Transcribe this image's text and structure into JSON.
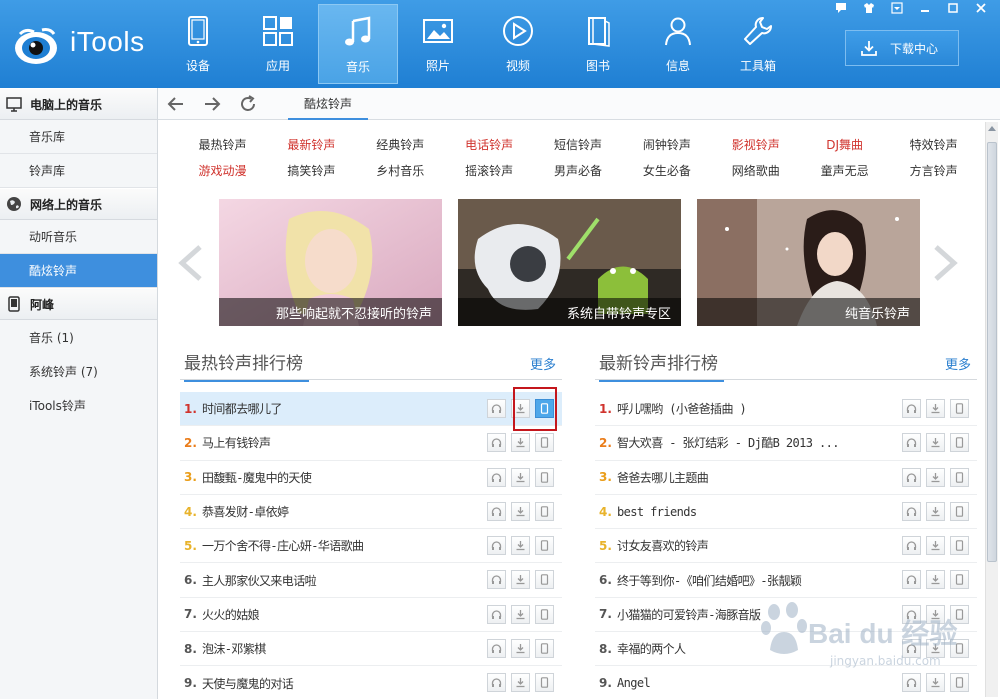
{
  "app": {
    "logo_text": "iTools"
  },
  "nav": [
    {
      "label": "设备",
      "icon": "tablet-icon"
    },
    {
      "label": "应用",
      "icon": "apps-grid-icon"
    },
    {
      "label": "音乐",
      "icon": "music-note-icon"
    },
    {
      "label": "照片",
      "icon": "photo-icon"
    },
    {
      "label": "视频",
      "icon": "play-video-icon"
    },
    {
      "label": "图书",
      "icon": "book-icon"
    },
    {
      "label": "信息",
      "icon": "person-icon"
    },
    {
      "label": "工具箱",
      "icon": "wrench-icon"
    }
  ],
  "nav_active": "音乐",
  "download_center": "下载中心",
  "sidebar": {
    "groups": [
      {
        "title": "电脑上的音乐",
        "icon": "monitor-icon",
        "items": [
          "音乐库",
          "铃声库"
        ]
      },
      {
        "title": "网络上的音乐",
        "icon": "globe-icon",
        "items": [
          "动听音乐",
          "酷炫铃声"
        ]
      },
      {
        "title": "阿峰",
        "icon": "phone-icon",
        "items": [
          "音乐 (1)",
          "系统铃声 (7)",
          "iTools铃声"
        ]
      }
    ],
    "active_item": "酷炫铃声"
  },
  "toolbar": {
    "tab": "酷炫铃声"
  },
  "categories": [
    [
      {
        "label": "最热铃声",
        "red": false
      },
      {
        "label": "最新铃声",
        "red": true
      },
      {
        "label": "经典铃声",
        "red": false
      },
      {
        "label": "电话铃声",
        "red": true
      },
      {
        "label": "短信铃声",
        "red": false
      },
      {
        "label": "闹钟铃声",
        "red": false
      },
      {
        "label": "影视铃声",
        "red": true
      },
      {
        "label": "DJ舞曲",
        "red": true
      },
      {
        "label": "特效铃声",
        "red": false
      }
    ],
    [
      {
        "label": "游戏动漫",
        "red": true
      },
      {
        "label": "搞笑铃声",
        "red": false
      },
      {
        "label": "乡村音乐",
        "red": false
      },
      {
        "label": "摇滚铃声",
        "red": false
      },
      {
        "label": "男声必备",
        "red": false
      },
      {
        "label": "女生必备",
        "red": false
      },
      {
        "label": "网络歌曲",
        "red": false
      },
      {
        "label": "童声无忌",
        "red": false
      },
      {
        "label": "方言铃声",
        "red": false
      }
    ]
  ],
  "banners": [
    "那些响起就不忍接听的铃声",
    "系统自带铃声专区",
    "纯音乐铃声"
  ],
  "hot_list": {
    "title": "最热铃声排行榜",
    "more": "更多",
    "items": [
      "时间都去哪儿了",
      "马上有钱铃声",
      "田馥甄-魔鬼中的天使",
      "恭喜发财-卓依婷",
      "一万个舍不得-庄心妍-华语歌曲",
      "主人那家伙又来电话啦",
      "火火的姑娘",
      "泡沫-邓紫棋",
      "天使与魔鬼的对话"
    ]
  },
  "new_list": {
    "title": "最新铃声排行榜",
    "more": "更多",
    "items": [
      "呼儿嘿哟 (小爸爸插曲 )",
      "智大欢喜 - 张灯结彩 - Dj酷B 2013 ...",
      "爸爸去哪儿主题曲",
      "best friends",
      "讨女友喜欢的铃声",
      "终于等到你-《咱们结婚吧》-张靓颖",
      "小猫猫的可爱铃声-海豚音版",
      "幸福的两个人",
      "Angel"
    ]
  },
  "watermark": {
    "text": "Bai du 经验",
    "sub": "jingyan.baidu.com"
  }
}
